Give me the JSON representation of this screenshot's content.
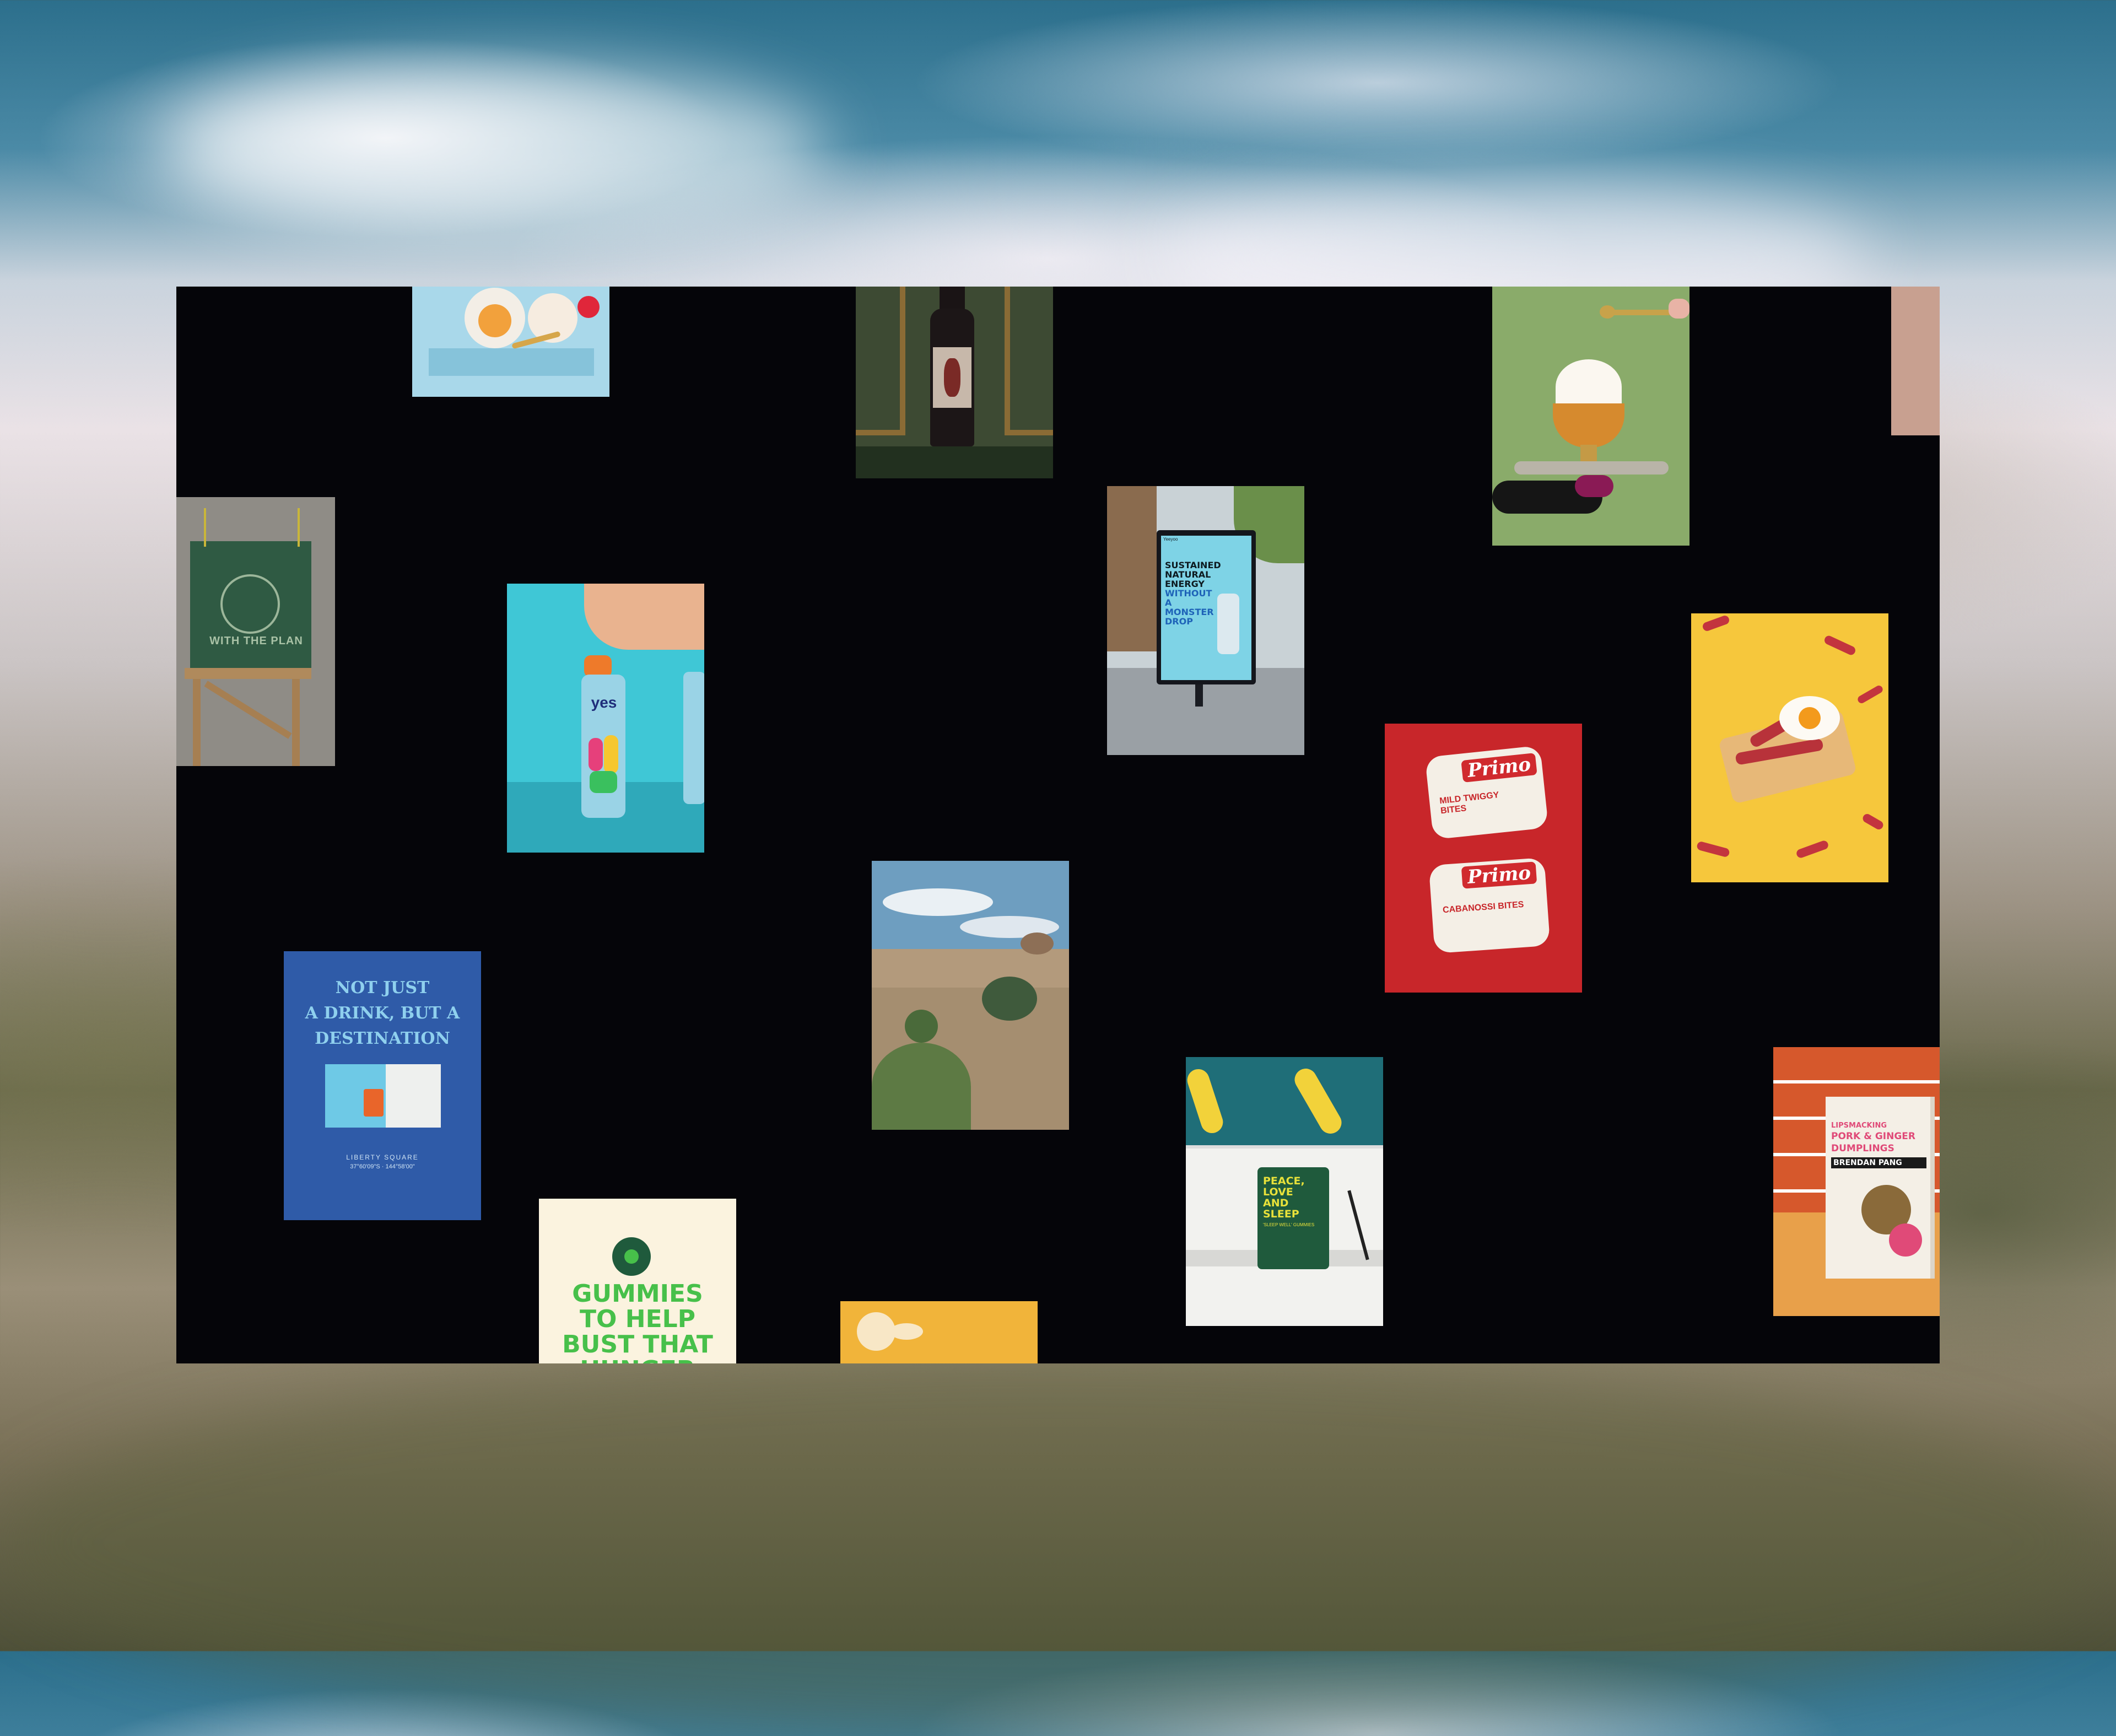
{
  "gallery": {
    "posters": {
      "ad_shelter": {
        "brand": "Yeeyoo",
        "headline_lines": [
          "SUSTAINED",
          "NATURAL",
          "ENERGY",
          "WITHOUT",
          "A MONSTER",
          "DROP"
        ]
      },
      "destination": {
        "headline_lines": [
          "NOT JUST",
          "A DRINK, BUT A",
          "DESTINATION"
        ],
        "place": "LIBERTY SQUARE",
        "coordinates": "37°60'09\"S · 144°58'00\""
      },
      "gummies": {
        "headline_lines": [
          "GUMMIES",
          "TO HELP",
          "BUST THAT",
          "HUNGER"
        ]
      },
      "tote_bag": {
        "text": "WITH THE PLAN"
      },
      "yes_can": {
        "brand": "yes"
      }
    },
    "packaging": {
      "primo": {
        "brand": "Primo",
        "top_pack": "MILD TWIGGY BITES",
        "bottom_pack": "CABANOSSI BITES"
      },
      "sleep_pouch": {
        "headline_lines": [
          "PEACE,",
          "LOVE",
          "AND",
          "SLEEP"
        ],
        "sub": "'SLEEP WELL' GUMMIES"
      },
      "dumplings": {
        "line1": "LIPSMACKING",
        "line2": "PORK & GINGER",
        "line3": "DUMPLINGS",
        "brand": "BRENDAN PANG"
      }
    }
  }
}
